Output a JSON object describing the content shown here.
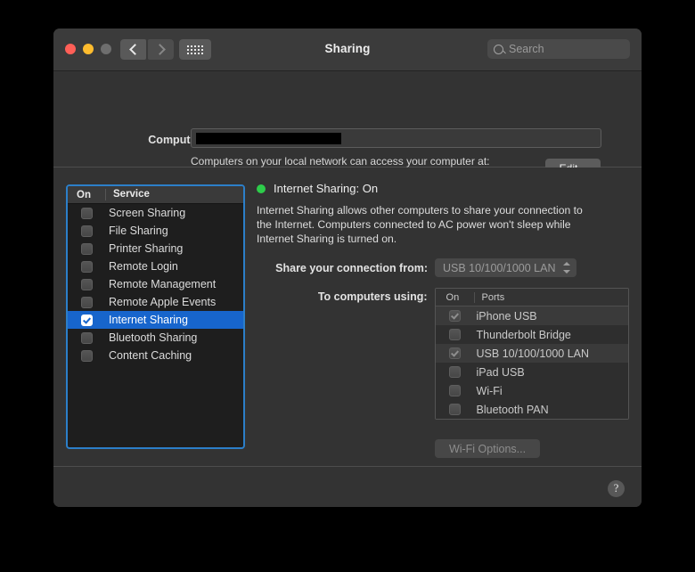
{
  "window": {
    "title": "Sharing",
    "traffic_lights": [
      "close-button",
      "minimize-button",
      "zoom-button"
    ],
    "nav": {
      "back": "back-icon",
      "forward": "forward-icon",
      "grid": "all-preferences-icon"
    },
    "search": {
      "placeholder": "Search",
      "value": "",
      "icon": "search-icon"
    }
  },
  "top": {
    "computer_name_label": "Computer Name:",
    "computer_name_value": "",
    "host_note": "Computers on your local network can access your computer at:",
    "host_value": "",
    "edit_label": "Edit..."
  },
  "services": {
    "header": {
      "on": "On",
      "service": "Service"
    },
    "items": [
      {
        "label": "Screen Sharing",
        "checked": false,
        "selected": false
      },
      {
        "label": "File Sharing",
        "checked": false,
        "selected": false
      },
      {
        "label": "Printer Sharing",
        "checked": false,
        "selected": false
      },
      {
        "label": "Remote Login",
        "checked": false,
        "selected": false
      },
      {
        "label": "Remote Management",
        "checked": false,
        "selected": false
      },
      {
        "label": "Remote Apple Events",
        "checked": false,
        "selected": false
      },
      {
        "label": "Internet Sharing",
        "checked": true,
        "selected": true
      },
      {
        "label": "Bluetooth Sharing",
        "checked": false,
        "selected": false
      },
      {
        "label": "Content Caching",
        "checked": false,
        "selected": false
      }
    ]
  },
  "detail": {
    "status_text": "Internet Sharing: On",
    "status_color": "#2dcc4a",
    "description": "Internet Sharing allows other computers to share your connection to the Internet. Computers connected to AC power won't sleep while Internet Sharing is turned on.",
    "share_from_label": "Share your connection from:",
    "share_from_value": "USB 10/100/1000 LAN",
    "to_computers_label": "To computers using:",
    "ports_header": {
      "on": "On",
      "ports": "Ports"
    },
    "ports": [
      {
        "label": "iPhone USB",
        "checked": true
      },
      {
        "label": "Thunderbolt Bridge",
        "checked": false
      },
      {
        "label": "USB 10/100/1000 LAN",
        "checked": true
      },
      {
        "label": "iPad USB",
        "checked": false
      },
      {
        "label": "Wi-Fi",
        "checked": false
      },
      {
        "label": "Bluetooth PAN",
        "checked": false
      }
    ],
    "wifi_options_label": "Wi-Fi Options..."
  },
  "footer": {
    "help_label": "?"
  }
}
